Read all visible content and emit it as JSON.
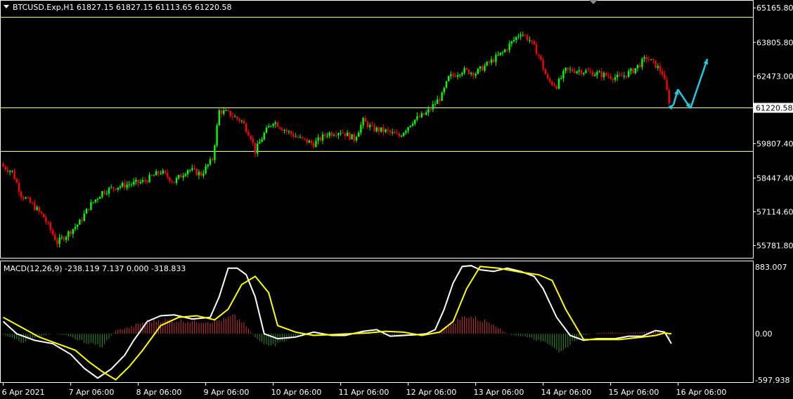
{
  "chart_data": [
    {
      "type": "candlestick",
      "title": "BTCUSD.Exp,H1  61827.15 61827.15 61113.65 61220.58",
      "symbol": "BTCUSD.Exp",
      "timeframe": "H1",
      "ohlc_last": {
        "open": "61827.15",
        "high": "61827.15",
        "low": "61113.65",
        "close": "61220.58"
      },
      "y_ticks": [
        "65165.80",
        "63805.80",
        "62473.00",
        "59807.40",
        "58447.40",
        "57114.60",
        "55781.80"
      ],
      "current_price_label": "61220.58",
      "ylim": [
        55300,
        65450
      ],
      "horizontal_levels": [
        64800,
        61220.58,
        59500
      ],
      "bull_color": "#00ff00",
      "bear_color": "#ff0000",
      "level_color": "#ffff66",
      "projection_color": "#22c8e0",
      "projection_path": [
        [
          0,
          61200
        ],
        [
          1,
          61350
        ],
        [
          2,
          61950
        ],
        [
          5,
          61200
        ],
        [
          9,
          63150
        ]
      ],
      "close_anchors": [
        [
          0,
          58900
        ],
        [
          4,
          58700
        ],
        [
          8,
          57800
        ],
        [
          14,
          57300
        ],
        [
          18,
          56900
        ],
        [
          24,
          55900
        ],
        [
          28,
          56200
        ],
        [
          34,
          56700
        ],
        [
          38,
          57300
        ],
        [
          44,
          57900
        ],
        [
          50,
          58100
        ],
        [
          56,
          58200
        ],
        [
          62,
          58300
        ],
        [
          70,
          58700
        ],
        [
          76,
          58300
        ],
        [
          82,
          58800
        ],
        [
          88,
          58600
        ],
        [
          93,
          59200
        ],
        [
          96,
          61100
        ],
        [
          100,
          61000
        ],
        [
          106,
          60700
        ],
        [
          110,
          60100
        ],
        [
          112,
          59500
        ],
        [
          116,
          60200
        ],
        [
          120,
          60700
        ],
        [
          126,
          60300
        ],
        [
          132,
          60000
        ],
        [
          138,
          59800
        ],
        [
          144,
          60200
        ],
        [
          150,
          60300
        ],
        [
          156,
          60000
        ],
        [
          160,
          60700
        ],
        [
          164,
          60400
        ],
        [
          170,
          60300
        ],
        [
          176,
          60100
        ],
        [
          182,
          60700
        ],
        [
          188,
          61000
        ],
        [
          192,
          61400
        ],
        [
          195,
          61700
        ],
        [
          198,
          62400
        ],
        [
          204,
          62700
        ],
        [
          210,
          62600
        ],
        [
          216,
          63000
        ],
        [
          222,
          63400
        ],
        [
          226,
          63800
        ],
        [
          230,
          64200
        ],
        [
          234,
          63900
        ],
        [
          238,
          63300
        ],
        [
          242,
          62300
        ],
        [
          246,
          62100
        ],
        [
          250,
          62700
        ],
        [
          256,
          62700
        ],
        [
          262,
          62600
        ],
        [
          268,
          62500
        ],
        [
          274,
          62400
        ],
        [
          280,
          62700
        ],
        [
          286,
          63200
        ],
        [
          290,
          62900
        ],
        [
          293,
          62600
        ],
        [
          296,
          61500
        ]
      ]
    },
    {
      "type": "line",
      "title": "MACD(12,26,9) -238.119 7.137 0.000 -318.833",
      "indicator": "MACD(12,26,9)",
      "values_label": "-238.119 7.137 0.000 -318.833",
      "y_ticks": [
        "883.007",
        "0.00",
        "-597.938"
      ],
      "ylim": [
        -597.938,
        883.007
      ],
      "series": [
        {
          "name": "",
          "color": "#ffffff",
          "points": [
            [
              0,
              150
            ],
            [
              6,
              0
            ],
            [
              14,
              -80
            ],
            [
              22,
              -120
            ],
            [
              30,
              -250
            ],
            [
              36,
              -420
            ],
            [
              42,
              -540
            ],
            [
              48,
              -430
            ],
            [
              54,
              -260
            ],
            [
              58,
              -80
            ],
            [
              64,
              150
            ],
            [
              70,
              220
            ],
            [
              76,
              230
            ],
            [
              84,
              180
            ],
            [
              92,
              200
            ],
            [
              96,
              450
            ],
            [
              100,
              800
            ],
            [
              104,
              800
            ],
            [
              108,
              720
            ],
            [
              112,
              450
            ],
            [
              116,
              0
            ],
            [
              122,
              -60
            ],
            [
              130,
              -40
            ],
            [
              138,
              20
            ],
            [
              146,
              -20
            ],
            [
              152,
              -20
            ],
            [
              160,
              30
            ],
            [
              166,
              50
            ],
            [
              172,
              -30
            ],
            [
              178,
              -20
            ],
            [
              184,
              -10
            ],
            [
              188,
              0
            ],
            [
              192,
              50
            ],
            [
              196,
              300
            ],
            [
              200,
              620
            ],
            [
              204,
              820
            ],
            [
              208,
              830
            ],
            [
              212,
              780
            ],
            [
              218,
              760
            ],
            [
              224,
              800
            ],
            [
              230,
              760
            ],
            [
              236,
              700
            ],
            [
              240,
              550
            ],
            [
              246,
              200
            ],
            [
              252,
              -20
            ],
            [
              258,
              -80
            ],
            [
              264,
              -60
            ],
            [
              272,
              -60
            ],
            [
              278,
              -30
            ],
            [
              284,
              -30
            ],
            [
              290,
              40
            ],
            [
              294,
              20
            ],
            [
              297,
              -120
            ]
          ]
        },
        {
          "name": "",
          "color": "#ffff00",
          "points": [
            [
              0,
              200
            ],
            [
              8,
              80
            ],
            [
              16,
              -40
            ],
            [
              24,
              -120
            ],
            [
              32,
              -200
            ],
            [
              38,
              -340
            ],
            [
              44,
              -460
            ],
            [
              50,
              -560
            ],
            [
              56,
              -400
            ],
            [
              62,
              -200
            ],
            [
              70,
              100
            ],
            [
              78,
              200
            ],
            [
              86,
              220
            ],
            [
              94,
              170
            ],
            [
              100,
              300
            ],
            [
              106,
              600
            ],
            [
              112,
              700
            ],
            [
              118,
              500
            ],
            [
              122,
              100
            ],
            [
              130,
              20
            ],
            [
              138,
              -20
            ],
            [
              146,
              -10
            ],
            [
              154,
              0
            ],
            [
              162,
              10
            ],
            [
              170,
              30
            ],
            [
              178,
              20
            ],
            [
              186,
              -20
            ],
            [
              194,
              20
            ],
            [
              200,
              150
            ],
            [
              206,
              550
            ],
            [
              212,
              820
            ],
            [
              220,
              800
            ],
            [
              230,
              750
            ],
            [
              238,
              720
            ],
            [
              244,
              650
            ],
            [
              250,
              300
            ],
            [
              258,
              -70
            ],
            [
              266,
              -70
            ],
            [
              274,
              -70
            ],
            [
              284,
              -40
            ],
            [
              290,
              -20
            ],
            [
              294,
              10
            ],
            [
              297,
              0
            ]
          ]
        }
      ],
      "histogram": {
        "bull_color": "#cc3333",
        "bear_color": "#2e8b2e",
        "anchors": [
          [
            0,
            -10
          ],
          [
            8,
            -120
          ],
          [
            16,
            -40
          ],
          [
            22,
            0
          ],
          [
            28,
            -20
          ],
          [
            36,
            -120
          ],
          [
            44,
            -180
          ],
          [
            50,
            50
          ],
          [
            56,
            90
          ],
          [
            64,
            180
          ],
          [
            70,
            200
          ],
          [
            76,
            190
          ],
          [
            84,
            180
          ],
          [
            92,
            180
          ],
          [
            98,
            200
          ],
          [
            102,
            250
          ],
          [
            106,
            180
          ],
          [
            112,
            -50
          ],
          [
            118,
            -200
          ],
          [
            124,
            -120
          ],
          [
            130,
            -40
          ],
          [
            138,
            -20
          ],
          [
            146,
            -10
          ],
          [
            152,
            0
          ],
          [
            160,
            20
          ],
          [
            166,
            -10
          ],
          [
            172,
            -20
          ],
          [
            180,
            -30
          ],
          [
            186,
            -20
          ],
          [
            194,
            40
          ],
          [
            200,
            160
          ],
          [
            206,
            260
          ],
          [
            212,
            200
          ],
          [
            218,
            150
          ],
          [
            222,
            40
          ],
          [
            226,
            -20
          ],
          [
            232,
            -40
          ],
          [
            240,
            -120
          ],
          [
            246,
            -250
          ],
          [
            252,
            -150
          ],
          [
            258,
            -20
          ],
          [
            264,
            10
          ],
          [
            270,
            20
          ],
          [
            276,
            10
          ],
          [
            282,
            20
          ],
          [
            288,
            40
          ],
          [
            294,
            20
          ],
          [
            297,
            -150
          ]
        ]
      }
    }
  ],
  "x_ticks": [
    {
      "label": "6 Apr 2021",
      "bar": 0
    },
    {
      "label": "7 Apr 06:00",
      "bar": 30
    },
    {
      "label": "8 Apr 06:00",
      "bar": 60
    },
    {
      "label": "9 Apr 06:00",
      "bar": 90
    },
    {
      "label": "10 Apr 06:00",
      "bar": 120
    },
    {
      "label": "11 Apr 06:00",
      "bar": 150
    },
    {
      "label": "12 Apr 06:00",
      "bar": 180
    },
    {
      "label": "13 Apr 06:00",
      "bar": 210
    },
    {
      "label": "14 Apr 06:00",
      "bar": 240
    },
    {
      "label": "15 Apr 06:00",
      "bar": 270
    },
    {
      "label": "16 Apr 06:00",
      "bar": 300
    }
  ]
}
